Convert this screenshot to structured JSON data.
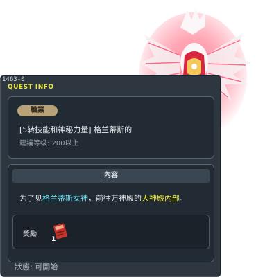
{
  "window": {
    "quest_id": "1463-0",
    "title": "QUEST INFO"
  },
  "job": {
    "badge": "職業",
    "title": "[5转技能和神秘力量] 格兰蒂斯的",
    "level": "建議等级: 200以上"
  },
  "content": {
    "header": "內容",
    "text_1": "为了见",
    "text_2": "格兰蒂斯女神",
    "text_3": "，前往万神殿的",
    "text_4": "大神殿內部",
    "text_5": "。"
  },
  "reward": {
    "label": "獎勵",
    "item_count": "1",
    "item_icon": "red-scroll-icon"
  },
  "status": {
    "text": "狀態: 可開始"
  },
  "colors": {
    "highlight_cyan": "#6fe3f6",
    "highlight_yellow": "#f0f040",
    "title_yellow": "#e8e840",
    "window_bg": "#2e3640"
  }
}
